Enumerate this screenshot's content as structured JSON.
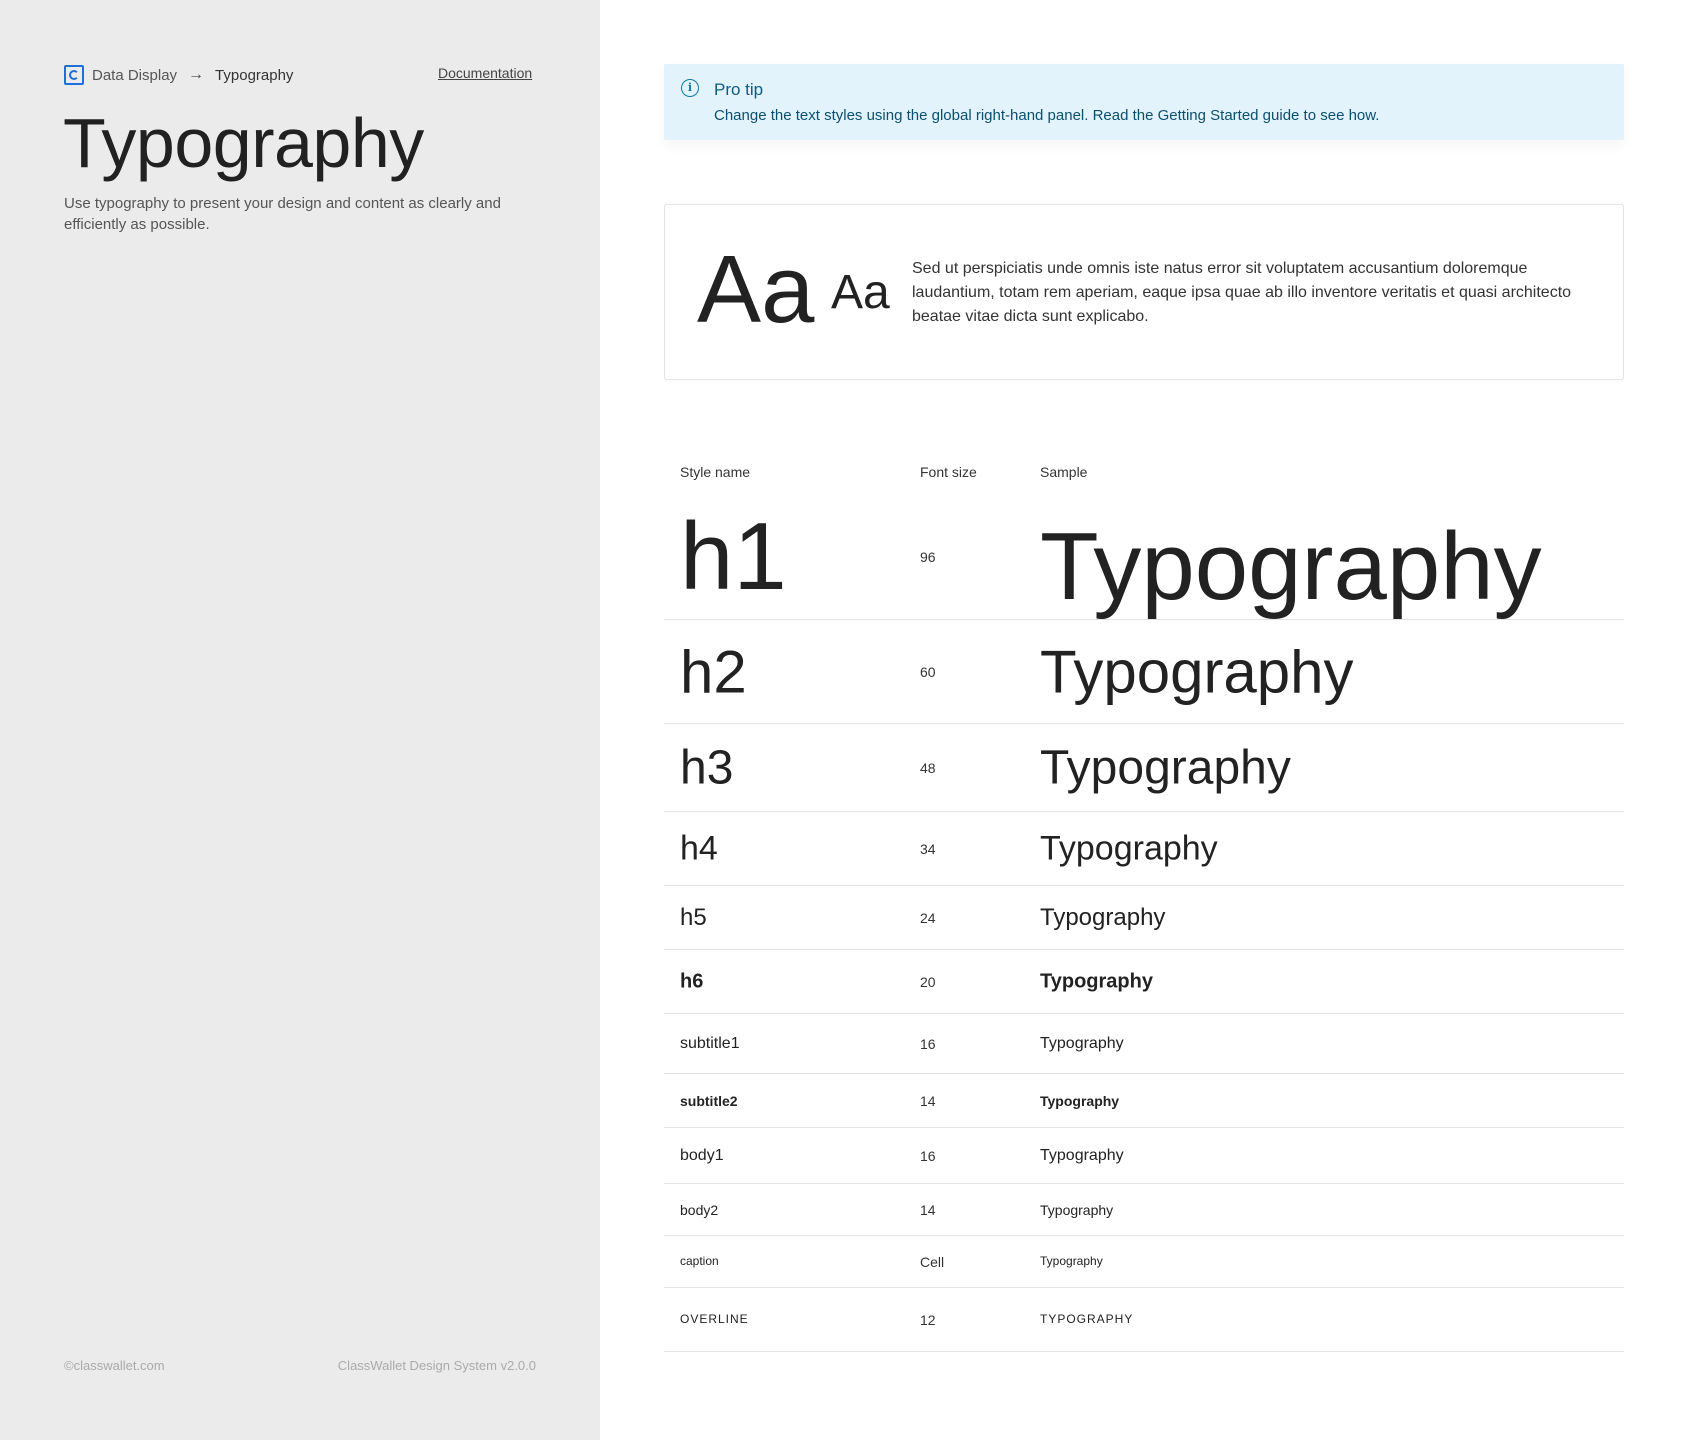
{
  "breadcrumb": {
    "parent": "Data Display",
    "current": "Typography"
  },
  "documentation_link": "Documentation",
  "page": {
    "title": "Typography",
    "description": "Use typography to present your design and content as clearly and efficiently as possible."
  },
  "footer": {
    "copyright": "©classwallet.com",
    "version": "ClassWallet Design System v2.0.0"
  },
  "tip": {
    "title": "Pro tip",
    "text": "Change the text styles using the global right-hand panel. Read the Getting Started guide to see how.",
    "icon": "info-icon"
  },
  "sample_card": {
    "aa_large": "Aa",
    "aa_small": "Aa",
    "paragraph": "Sed ut perspiciatis unde omnis iste natus error sit voluptatem accusantium doloremque laudantium, totam rem aperiam, eaque ipsa quae ab illo inventore veritatis et quasi architecto beatae vitae dicta sunt explicabo."
  },
  "table": {
    "headers": {
      "style_name": "Style name",
      "font_size": "Font size",
      "sample": "Sample"
    },
    "rows": [
      {
        "name": "h1",
        "size": "96",
        "sample": "Typography"
      },
      {
        "name": "h2",
        "size": "60",
        "sample": "Typography"
      },
      {
        "name": "h3",
        "size": "48",
        "sample": "Typography"
      },
      {
        "name": "h4",
        "size": "34",
        "sample": "Typography"
      },
      {
        "name": "h5",
        "size": "24",
        "sample": "Typography"
      },
      {
        "name": "h6",
        "size": "20",
        "sample": "Typography"
      },
      {
        "name": "subtitle1",
        "size": "16",
        "sample": "Typography"
      },
      {
        "name": "subtitle2",
        "size": "14",
        "sample": "Typography"
      },
      {
        "name": "body1",
        "size": "16",
        "sample": "Typography"
      },
      {
        "name": "body2",
        "size": "14",
        "sample": "Typography"
      },
      {
        "name": "caption",
        "size": "Cell",
        "sample": "Typography"
      },
      {
        "name": "OVERLINE",
        "size": "12",
        "sample": "TYPOGRAPHY"
      }
    ]
  },
  "colors": {
    "left_panel": "#ebebeb",
    "tip_background": "#e2f3fb",
    "tip_accent": "#0e7aae",
    "brand": "#1e6fd9"
  }
}
